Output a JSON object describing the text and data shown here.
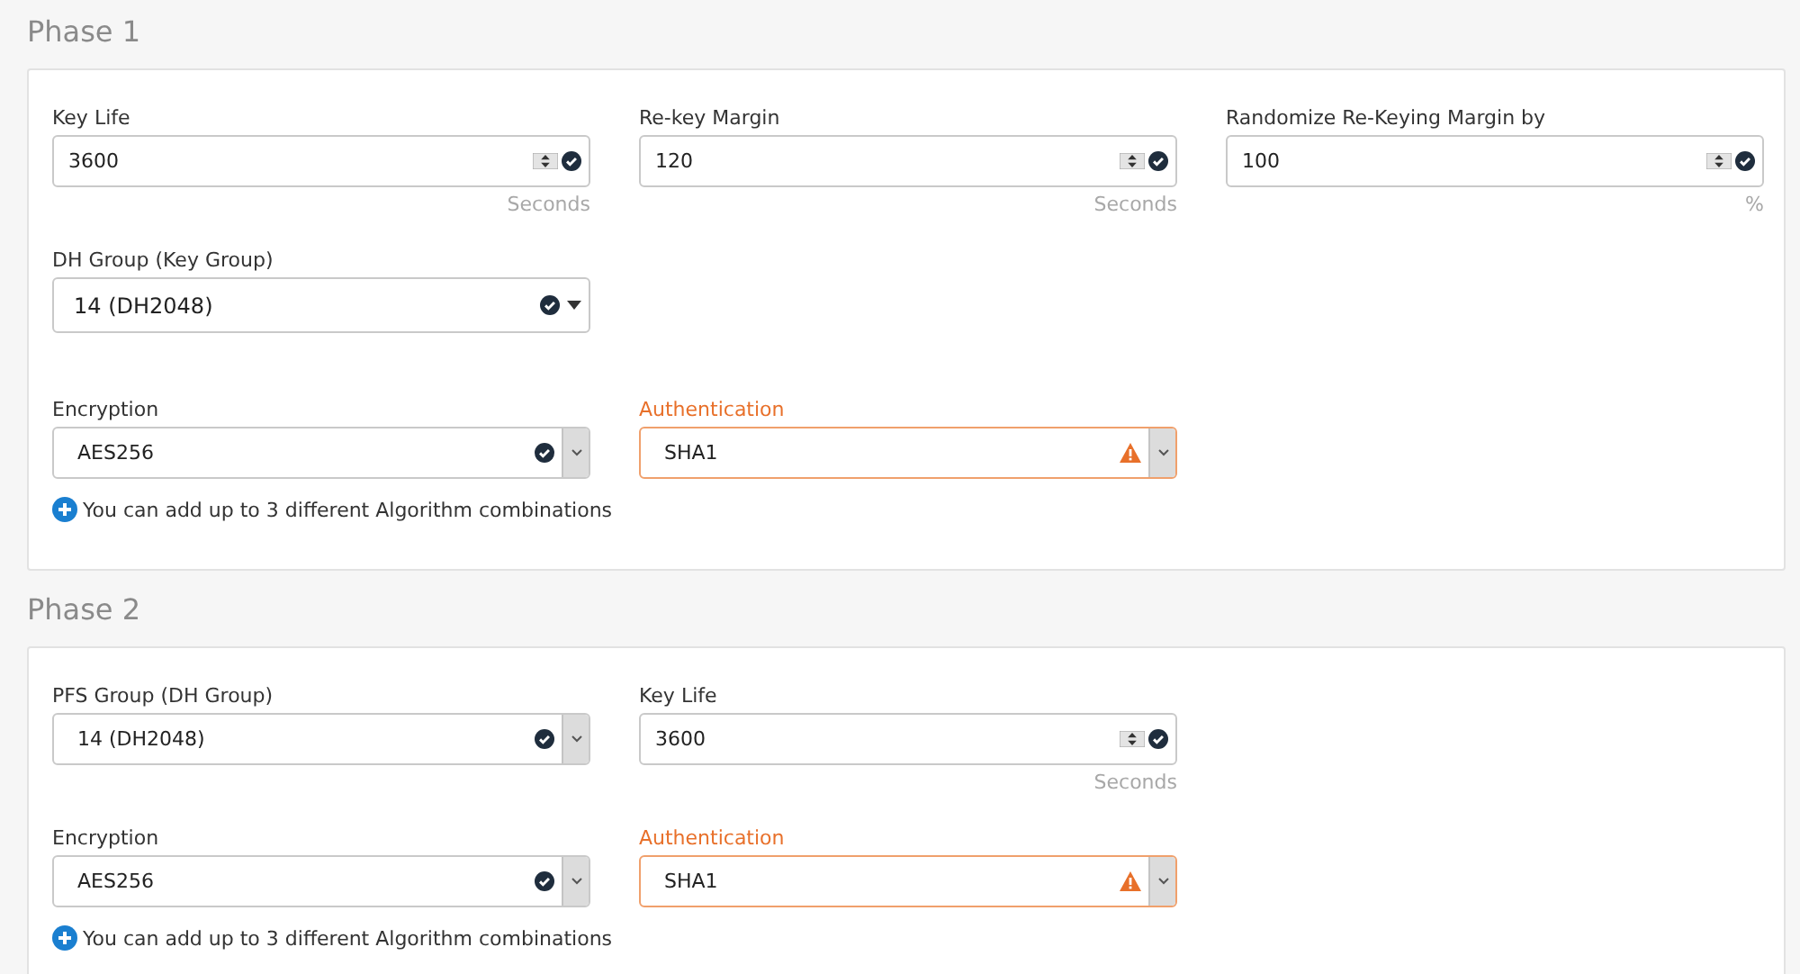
{
  "phases": [
    {
      "title": "Phase 1",
      "rows": [
        [
          {
            "label": "Key Life",
            "kind": "number",
            "value": "3600",
            "warning": false,
            "unit": "Seconds"
          },
          {
            "label": "Re-key Margin",
            "kind": "number",
            "value": "120",
            "warning": false,
            "unit": "Seconds"
          },
          {
            "label": "Randomize Re-Keying Margin by",
            "kind": "number",
            "value": "100",
            "warning": false,
            "unit": "%"
          }
        ],
        [
          {
            "label": "DH Group (Key Group)",
            "kind": "select",
            "value": "14 (DH2048)",
            "warning": false
          }
        ],
        [
          {
            "label": "Encryption",
            "kind": "combo",
            "value": "AES256",
            "warning": false
          },
          {
            "label": "Authentication",
            "kind": "combo",
            "value": "SHA1",
            "warning": true
          }
        ]
      ],
      "note": "You can add up to 3 different Algorithm combinations"
    },
    {
      "title": "Phase 2",
      "rows": [
        [
          {
            "label": "PFS Group (DH Group)",
            "kind": "combo",
            "value": "14 (DH2048)",
            "warning": false
          },
          {
            "label": "Key Life",
            "kind": "number",
            "value": "3600",
            "warning": false,
            "unit": "Seconds"
          }
        ],
        [
          {
            "label": "Encryption",
            "kind": "combo",
            "value": "AES256",
            "warning": false
          },
          {
            "label": "Authentication",
            "kind": "combo",
            "value": "SHA1",
            "warning": true
          }
        ]
      ],
      "note": "You can add up to 3 different Algorithm combinations"
    }
  ]
}
